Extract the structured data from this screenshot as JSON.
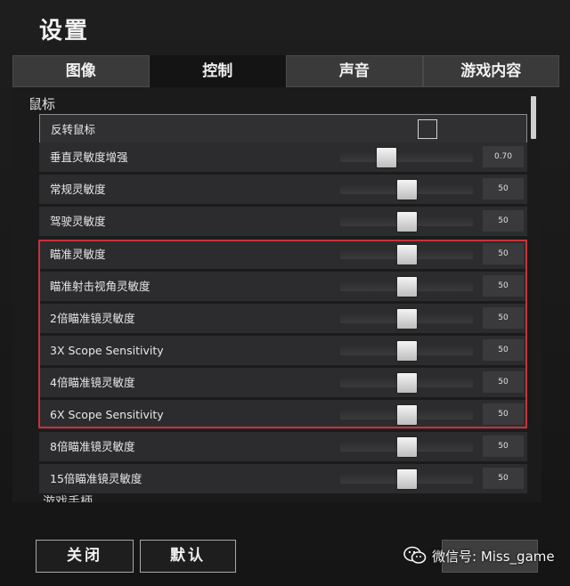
{
  "title": "设置",
  "tabs": [
    {
      "label": "图像",
      "active": false
    },
    {
      "label": "控制",
      "active": true
    },
    {
      "label": "声音",
      "active": false
    },
    {
      "label": "游戏内容",
      "active": false
    }
  ],
  "section": "鼠标",
  "rows": [
    {
      "label": "反转鼠标",
      "kind": "checkbox",
      "checked": false
    },
    {
      "label": "垂直灵敏度增强",
      "kind": "slider",
      "value": "0.70",
      "fill": 0.35
    },
    {
      "label": "常规灵敏度",
      "kind": "slider",
      "value": "50",
      "fill": 0.5
    },
    {
      "label": "驾驶灵敏度",
      "kind": "slider",
      "value": "50",
      "fill": 0.5
    },
    {
      "label": "瞄准灵敏度",
      "kind": "slider",
      "value": "50",
      "fill": 0.5
    },
    {
      "label": "瞄准射击视角灵敏度",
      "kind": "slider",
      "value": "50",
      "fill": 0.5
    },
    {
      "label": "2倍瞄准镜灵敏度",
      "kind": "slider",
      "value": "50",
      "fill": 0.5
    },
    {
      "label": "3X Scope Sensitivity",
      "kind": "slider",
      "value": "50",
      "fill": 0.5
    },
    {
      "label": "4倍瞄准镜灵敏度",
      "kind": "slider",
      "value": "50",
      "fill": 0.5
    },
    {
      "label": "6X Scope Sensitivity",
      "kind": "slider",
      "value": "50",
      "fill": 0.5
    },
    {
      "label": "8倍瞄准镜灵敏度",
      "kind": "slider",
      "value": "50",
      "fill": 0.5
    },
    {
      "label": "15倍瞄准镜灵敏度",
      "kind": "slider",
      "value": "50",
      "fill": 0.5
    }
  ],
  "next_section": "游戏手柄",
  "footer": {
    "close_label": "关闭",
    "default_label": "默认"
  },
  "watermark": "微信号: Miss_game",
  "colors": {
    "highlight": "#c7323a",
    "background": "#1a1a1a",
    "active_tab": "#141414"
  }
}
